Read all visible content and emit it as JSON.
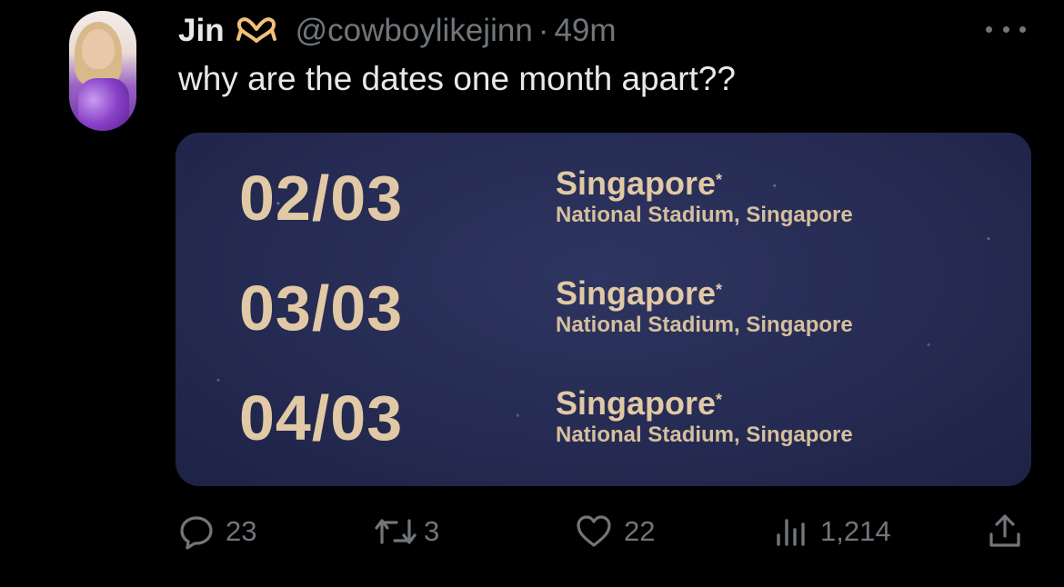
{
  "tweet": {
    "display_name": "Jin",
    "name_emoji": "heart-hands-icon",
    "handle": "@cowboylikejinn",
    "separator": "·",
    "time": "49m",
    "text": "why are the dates one month apart??"
  },
  "media": {
    "rows": [
      {
        "date": "02/03",
        "city": "Singapore",
        "city_mark": "*",
        "venue": "National Stadium, Singapore"
      },
      {
        "date": "03/03",
        "city": "Singapore",
        "city_mark": "*",
        "venue": "National Stadium, Singapore"
      },
      {
        "date": "04/03",
        "city": "Singapore",
        "city_mark": "*",
        "venue": "National Stadium, Singapore"
      }
    ],
    "colors": {
      "background": "#252b52",
      "text": "#e2c9a6"
    }
  },
  "actions": {
    "replies": "23",
    "reposts": "3",
    "likes": "22",
    "views": "1,214"
  },
  "colors": {
    "background": "#000000",
    "primary_text": "#e7e9ea",
    "secondary_text": "#71767b"
  }
}
